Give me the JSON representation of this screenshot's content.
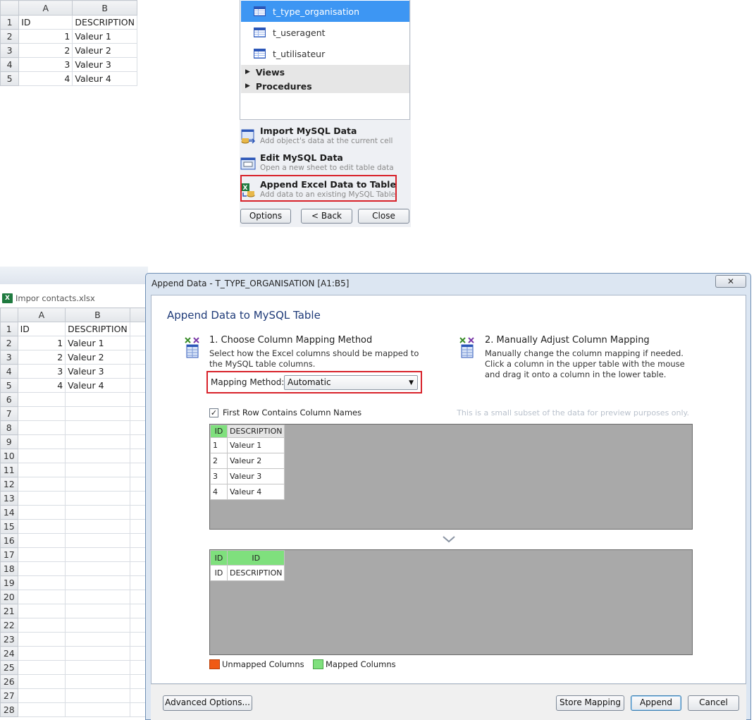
{
  "spreadsheet_top": {
    "columns": [
      "A",
      "B"
    ],
    "rows": [
      {
        "n": "1",
        "a": "ID",
        "b": "DESCRIPTION"
      },
      {
        "n": "2",
        "a": "1",
        "b": "Valeur 1"
      },
      {
        "n": "3",
        "a": "2",
        "b": "Valeur 2"
      },
      {
        "n": "4",
        "a": "3",
        "b": "Valeur 3"
      },
      {
        "n": "5",
        "a": "4",
        "b": "Valeur 4"
      }
    ]
  },
  "object_panel": {
    "tables": [
      "t_type_organisation",
      "t_useragent",
      "t_utilisateur"
    ],
    "groups": [
      "Views",
      "Procedures"
    ],
    "actions": [
      {
        "title": "Import MySQL Data",
        "subtitle": "Add object's data at the current cell"
      },
      {
        "title": "Edit MySQL Data",
        "subtitle": "Open a new sheet to edit table data"
      },
      {
        "title": "Append Excel Data to Table",
        "subtitle": "Add data to an existing MySQL Table"
      }
    ],
    "buttons": {
      "options": "Options",
      "back": "< Back",
      "close": "Close"
    }
  },
  "excel_window": {
    "tab_name": "Impor contacts.xlsx",
    "columns": [
      "A",
      "B"
    ],
    "rows": [
      {
        "n": "1",
        "a": "ID",
        "b": "DESCRIPTION"
      },
      {
        "n": "2",
        "a": "1",
        "b": "Valeur 1"
      },
      {
        "n": "3",
        "a": "2",
        "b": "Valeur 2"
      },
      {
        "n": "4",
        "a": "3",
        "b": "Valeur 3"
      },
      {
        "n": "5",
        "a": "4",
        "b": "Valeur 4"
      }
    ],
    "empty_row_numbers": [
      "6",
      "7",
      "8",
      "9",
      "10",
      "11",
      "12",
      "13",
      "14",
      "15",
      "16",
      "17",
      "18",
      "19",
      "20",
      "21",
      "22",
      "23",
      "24",
      "25",
      "26",
      "27",
      "28"
    ]
  },
  "dialog": {
    "title": "Append Data - T_TYPE_ORGANISATION [A1:B5]",
    "close_label": "✕",
    "heading": "Append Data to MySQL Table",
    "step1": {
      "title": "1. Choose Column Mapping Method",
      "desc": "Select how the Excel columns should be mapped to the MySQL table columns.",
      "mapping_label": "Mapping Method:",
      "mapping_value": "Automatic"
    },
    "step2": {
      "title": "2. Manually Adjust Column Mapping",
      "desc": "Manually change the column mapping if needed. Click a column in the upper table with the mouse and drag it onto a column in the lower table."
    },
    "first_row_label": "First Row Contains Column Names",
    "first_row_checked": true,
    "preview_note": "This is a small subset of the data for preview purposes only.",
    "source_grid": {
      "headers": [
        "ID",
        "DESCRIPTION"
      ],
      "rows": [
        [
          "1",
          "Valeur 1"
        ],
        [
          "2",
          "Valeur 2"
        ],
        [
          "3",
          "Valeur 3"
        ],
        [
          "4",
          "Valeur 4"
        ]
      ]
    },
    "target_grid": {
      "mapped_row": [
        "ID",
        "ID"
      ],
      "header_row": [
        "ID",
        "DESCRIPTION"
      ]
    },
    "legend": {
      "unmapped": "Unmapped Columns",
      "mapped": "Mapped Columns"
    },
    "footer": {
      "advanced": "Advanced Options...",
      "store": "Store Mapping",
      "append": "Append",
      "cancel": "Cancel"
    }
  },
  "colors": {
    "selection_blue": "#3d96f3",
    "highlight_red": "#d8222a",
    "mapped_green": "#7fe07d",
    "unmapped_orange": "#f05a14"
  }
}
